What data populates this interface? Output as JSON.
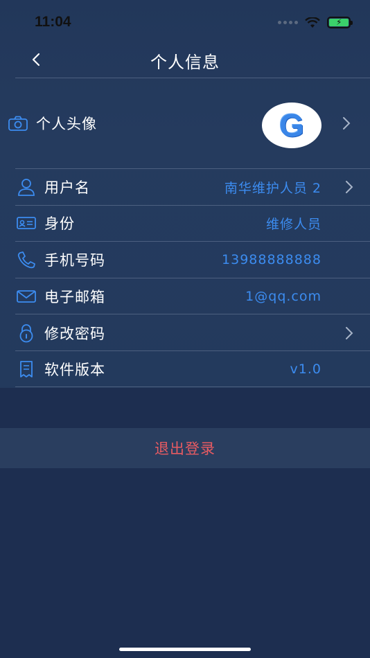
{
  "status_bar": {
    "time": "11:04"
  },
  "nav": {
    "title": "个人信息"
  },
  "avatar_row": {
    "label": "个人头像",
    "avatar_letter": "G"
  },
  "rows": [
    {
      "label": "用户名",
      "value": "南华维护人员 2",
      "icon": "user-icon",
      "chevron": true
    },
    {
      "label": "身份",
      "value": "维修人员",
      "icon": "id-card-icon",
      "chevron": false
    },
    {
      "label": "手机号码",
      "value": "13988888888",
      "icon": "phone-icon",
      "chevron": false
    },
    {
      "label": "电子邮箱",
      "value": "1@qq.com",
      "icon": "mail-icon",
      "chevron": false
    },
    {
      "label": "修改密码",
      "value": "",
      "icon": "lock-icon",
      "chevron": true
    },
    {
      "label": "软件版本",
      "value": "v1.0",
      "icon": "document-icon",
      "chevron": false
    }
  ],
  "logout": {
    "label": "退出登录"
  },
  "colors": {
    "accent": "#3c8cf0",
    "danger": "#e85b62",
    "background": "#1d2e50"
  }
}
